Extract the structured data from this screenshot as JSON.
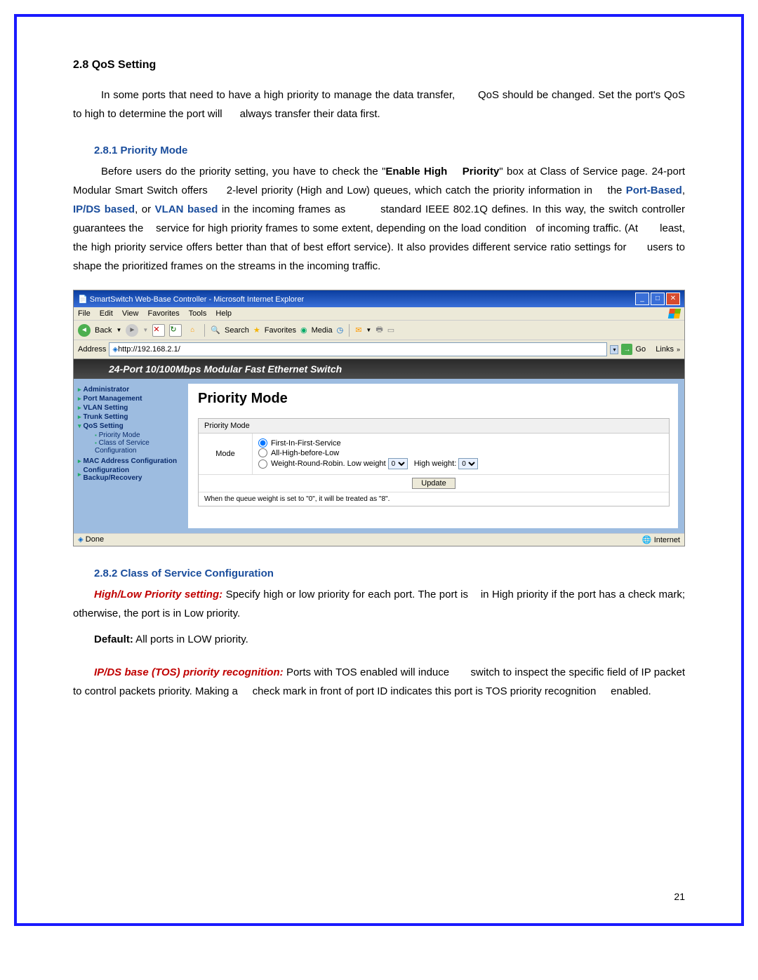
{
  "section": {
    "heading": "2.8 QoS Setting",
    "para1_a": "In some ports that need to have a high priority to manage the data transfer, ",
    "para1_b": "QoS should be changed. Set the port's QoS to high to determine the port will ",
    "para1_c": "always transfer their data first."
  },
  "sub1": {
    "heading": "2.8.1 Priority Mode",
    "t1": "Before users do the priority setting, you have to check the \"",
    "t2": "Enable High ",
    "t3": "Priority",
    "t4": "\" box at Class of Service page. 24-port Modular Smart Switch offers ",
    "t5": "2-level priority (High and Low) queues, which catch the priority information in ",
    "t6": "the ",
    "link1": "Port-Based",
    "link2": "IP/DS based",
    "link3": "VLAN based",
    "t7": ", ",
    "t8": ", or ",
    "t9": " in the incoming frames as ",
    "t10": "standard IEEE 802.1Q defines. In this way, the switch controller guarantees the ",
    "t11": "service for high priority frames to some extent, depending on the load condition ",
    "t12": "of incoming traffic. (At ",
    "t13": "least, the high priority service offers better than that of best effort service). It also provides different service ratio settings for ",
    "t14": "users to shape the prioritized frames on the streams in the incoming traffic."
  },
  "browser": {
    "title": "SmartSwitch Web-Base Controller - Microsoft Internet Explorer",
    "menus": [
      "File",
      "Edit",
      "View",
      "Favorites",
      "Tools",
      "Help"
    ],
    "back": "Back",
    "search": "Search",
    "favorites": "Favorites",
    "media": "Media",
    "addressLabel": "Address",
    "addressUrl": "http://192.168.2.1/",
    "go": "Go",
    "links": "Links",
    "statusDone": "Done",
    "statusZone": "Internet"
  },
  "switch": {
    "header": "24-Port 10/100Mbps Modular Fast Ethernet Switch",
    "nav": {
      "admin": "Administrator",
      "portMgmt": "Port Management",
      "vlan": "VLAN Setting",
      "trunk": "Trunk Setting",
      "qos": "QoS Setting",
      "qos_sub1": "Priority Mode",
      "qos_sub2": "Class of Service Configuration",
      "mac": "MAC Address Configuration",
      "config": "Configuration Backup/Recovery"
    },
    "main": {
      "title": "Priority Mode",
      "tableHeader": "Priority Mode",
      "modeLabel": "Mode",
      "opt1": "First-In-First-Service",
      "opt2": "All-High-before-Low",
      "opt3a": "Weight-Round-Robin. Low weight",
      "opt3b": "High weight:",
      "lowWeight": "0",
      "highWeight": "0",
      "updateBtn": "Update",
      "note": "When the queue weight is set to \"0\", it will be treated as \"8\"."
    }
  },
  "sub2": {
    "heading": "2.8.2 Class of Service Configuration",
    "lead1": "High/Low Priority setting:",
    "t1": " Specify high or low priority for each port. The port is ",
    "t2": "in High priority if the port has a check mark; otherwise, the port is in Low priority.",
    "defaultLabel": "Default:",
    "defaultText": " All ports in LOW priority.",
    "lead2": "IP/DS base (TOS) priority recognition:",
    "t3": " Ports with TOS enabled will induce ",
    "t4": "switch to inspect the specific field of IP packet to control packets priority. Making a ",
    "t5": "check mark in front of port ID indicates this port is TOS priority recognition ",
    "t6": "enabled."
  },
  "pageNumber": "21"
}
